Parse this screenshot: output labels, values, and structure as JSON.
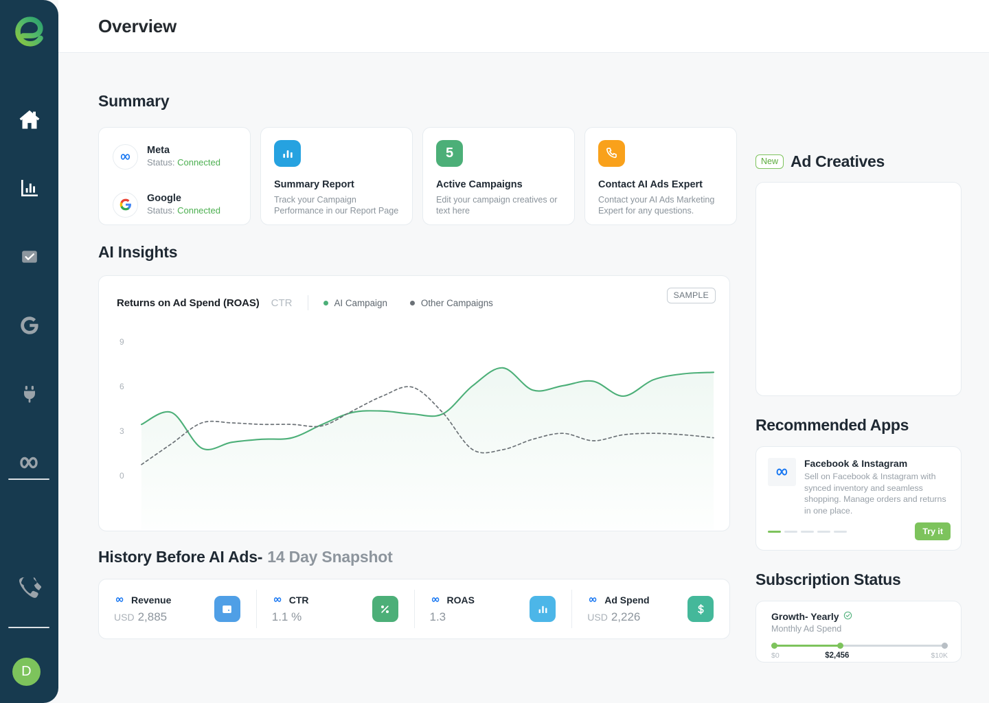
{
  "app": {
    "logo_letter": "e",
    "avatar_letter": "D"
  },
  "sidebar": {
    "items": [
      {
        "name": "home-icon",
        "label": "Home"
      },
      {
        "name": "analytics-icon",
        "label": "Analytics"
      },
      {
        "name": "checkbox-icon",
        "label": "Tasks"
      },
      {
        "name": "google-icon",
        "label": "Google"
      },
      {
        "name": "plug-icon",
        "label": "Integrations"
      },
      {
        "name": "meta-infinity-icon",
        "label": "Meta"
      }
    ],
    "phone_label": "Contact"
  },
  "header": {
    "title": "Overview"
  },
  "summary": {
    "title": "Summary",
    "connections": [
      {
        "name": "Meta",
        "status_label": "Status:",
        "status_value": "Connected"
      },
      {
        "name": "Google",
        "status_label": "Status:",
        "status_value": "Connected"
      }
    ],
    "tiles": [
      {
        "icon": "bar-chart-icon",
        "icon_text": "",
        "color": "#26a2e0",
        "title": "Summary Report",
        "desc": "Track your Campaign Performance in our Report Page"
      },
      {
        "icon": "count-badge",
        "icon_text": "5",
        "color": "#4caf78",
        "title": "Active Campaigns",
        "desc": "Edit your campaign creatives or text here"
      },
      {
        "icon": "phone-icon",
        "icon_text": "",
        "color": "#f9a11b",
        "title": "Contact AI Ads Expert",
        "desc": "Contact your AI Ads Marketing Expert for any questions."
      }
    ]
  },
  "insights": {
    "title": "AI Insights",
    "sample_badge": "SAMPLE"
  },
  "chart_data": {
    "type": "line",
    "title": "Returns on Ad Spend (ROAS)",
    "secondary_metric": "CTR",
    "xlabel": "",
    "ylabel": "",
    "ylim": [
      0,
      10
    ],
    "yticks": [
      0,
      3,
      6,
      9
    ],
    "ytick_labels": [
      "0",
      "3",
      "6",
      "9"
    ],
    "grid": false,
    "legend_position": "top-left",
    "x": [
      0,
      1,
      2,
      3,
      4,
      5,
      6,
      7,
      8,
      9,
      10,
      11,
      12,
      13,
      14,
      15,
      16,
      17,
      18,
      19
    ],
    "series": [
      {
        "name": "AI Campaign",
        "color": "#4caf78",
        "style": "solid",
        "filled": true,
        "values": [
          3.5,
          4.3,
          1.9,
          2.3,
          2.5,
          2.6,
          3.5,
          4.3,
          4.4,
          4.2,
          4.2,
          6.1,
          7.3,
          5.8,
          6.1,
          6.4,
          5.4,
          6.5,
          6.9,
          7.0
        ]
      },
      {
        "name": "Other Campaigns",
        "color": "#6b7176",
        "style": "dashed",
        "filled": false,
        "values": [
          0.8,
          2.2,
          3.6,
          3.6,
          3.5,
          3.5,
          3.4,
          4.4,
          5.4,
          6.0,
          4.3,
          1.8,
          1.8,
          2.5,
          2.9,
          2.4,
          2.8,
          2.9,
          2.8,
          2.6
        ]
      }
    ]
  },
  "history": {
    "title_strong": "History Before AI Ads-",
    "title_muted": "14 Day Snapshot",
    "items": [
      {
        "source_icon": "meta-icon",
        "label": "Revenue",
        "currency": "USD",
        "value": "2,885",
        "icon": "wallet-icon",
        "color": "#4f9fe6"
      },
      {
        "source_icon": "meta-icon",
        "label": "CTR",
        "currency": "",
        "value": "1.1 %",
        "icon": "percent-icon",
        "color": "#4caf78"
      },
      {
        "source_icon": "meta-icon",
        "label": "ROAS",
        "currency": "",
        "value": "1.3",
        "icon": "bar-chart-icon",
        "color": "#4cb6e8"
      },
      {
        "source_icon": "meta-icon",
        "label": "Ad Spend",
        "currency": "USD",
        "value": "2,226",
        "icon": "dollar-icon",
        "color": "#44b89a"
      }
    ]
  },
  "ad_creatives": {
    "badge": "New",
    "title": "Ad Creatives"
  },
  "recommended_apps": {
    "title": "Recommended Apps",
    "app": {
      "name": "Facebook & Instagram",
      "desc": "Sell on Facebook & Instagram with synced inventory and seamless shopping. Manage orders and returns in one place.",
      "cta": "Try it",
      "dots_total": 5,
      "dots_active": 1
    }
  },
  "subscription": {
    "title": "Subscription Status",
    "plan": "Growth- Yearly",
    "subtitle": "Monthly Ad Spend",
    "min_label": "$0",
    "current_label": "$2,456",
    "max_label": "$10K",
    "progress_percent": 39
  },
  "colors": {
    "sidebar_bg": "#173a4f",
    "accent_green": "#7dc35c",
    "chart_green": "#4caf78",
    "meta_blue": "#1877f2"
  }
}
